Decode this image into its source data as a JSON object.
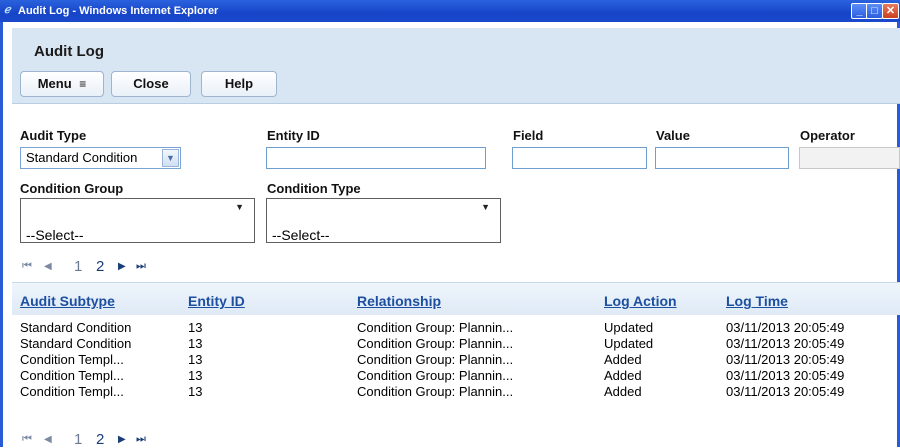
{
  "window": {
    "title": "Audit Log - Windows Internet Explorer",
    "icon": "ie-icon"
  },
  "header": {
    "title": "Audit Log",
    "buttons": {
      "menu": "Menu",
      "menu_icon": "≡",
      "close": "Close",
      "help": "Help"
    }
  },
  "filters": {
    "audit_type": {
      "label": "Audit Type",
      "value": "Standard Condition"
    },
    "entity_id": {
      "label": "Entity ID",
      "value": ""
    },
    "field": {
      "label": "Field",
      "value": ""
    },
    "value": {
      "label": "Value",
      "value": ""
    },
    "operator": {
      "label": "Operator",
      "value": ""
    },
    "condition_group": {
      "label": "Condition Group",
      "value": "--Select--"
    },
    "condition_type": {
      "label": "Condition Type",
      "value": "--Select--"
    }
  },
  "pager": {
    "pages": [
      "1",
      "2"
    ]
  },
  "table": {
    "columns": [
      "Audit Subtype",
      "Entity ID",
      "Relationship",
      "Log Action",
      "Log Time"
    ],
    "rows": [
      [
        "Standard Condition",
        "13",
        "Condition Group: Plannin...",
        "Updated",
        "03/11/2013 20:05:49"
      ],
      [
        "Standard Condition",
        "13",
        "Condition Group: Plannin...",
        "Updated",
        "03/11/2013 20:05:49"
      ],
      [
        "Condition Templ...",
        "13",
        "Condition Group: Plannin...",
        "Added",
        "03/11/2013 20:05:49"
      ],
      [
        "Condition Templ...",
        "13",
        "Condition Group: Plannin...",
        "Added",
        "03/11/2013 20:05:49"
      ],
      [
        "Condition Templ...",
        "13",
        "Condition Group: Plannin...",
        "Added",
        "03/11/2013 20:05:49"
      ]
    ]
  },
  "colors": {
    "titlebar": "#1744c8",
    "header_panel": "#d8e6f4",
    "link": "#1d4fa0"
  }
}
